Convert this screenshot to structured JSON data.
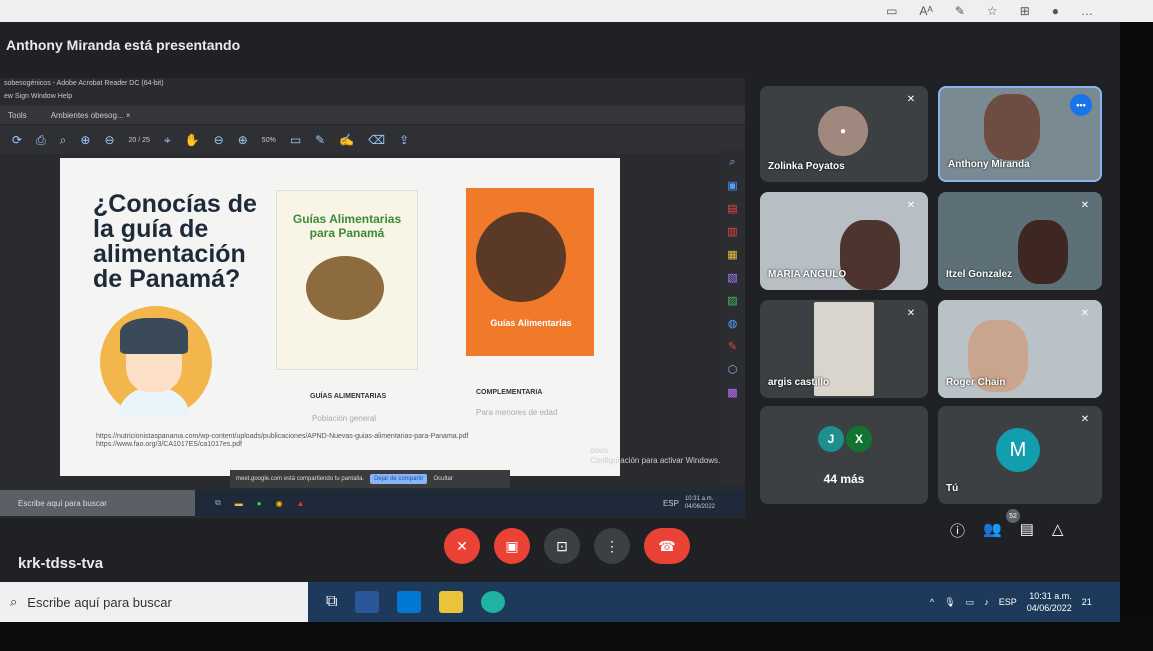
{
  "topbar": {
    "icons": [
      "window-icon",
      "text-size-icon",
      "read-aloud-icon",
      "favorites-icon",
      "collections-icon",
      "profile-icon",
      "more-icon"
    ]
  },
  "meet": {
    "presenting_text": "Anthony Miranda está presentando",
    "meeting_code": "krk-tdss-tva",
    "participants": [
      {
        "name": "Zolinka Poyatos"
      },
      {
        "name": "Anthony Miranda"
      },
      {
        "name": "MARIA ANGULO"
      },
      {
        "name": "Itzel Gonzalez"
      },
      {
        "name": "argis castillo"
      },
      {
        "name": "Roger Chain"
      }
    ],
    "more_tile": {
      "initials": [
        "J",
        "X"
      ],
      "label": "44 más"
    },
    "self_tile": {
      "initial": "M",
      "name": "Tú"
    },
    "people_count": "52"
  },
  "acrobat": {
    "title": "Ambientes obesog...",
    "window_title": "sobesogénicos - Adobe Acrobat Reader DC (64-bit)",
    "menu": "ew   Sign   Window   Help",
    "tabs": [
      "Tools",
      "Ambientes obesog...  ×"
    ],
    "page": "20 / 25",
    "zoom": "50%"
  },
  "slide": {
    "title": "¿Conocías de la guía de alimentación de Panamá?",
    "book1_title": "Guías Alimentarias para Panamá",
    "book2_title": "Guías Alimentarias",
    "caption1": "GUÍAS ALIMENTARIAS",
    "subcaption1": "Población general",
    "caption2": "COMPLEMENTARIA",
    "subcaption2": "Para menores de edad",
    "url1": "https://nutricionistaspanama.com/wp-content/uploads/publicaciones/APND-Nuevas-guias-alimentarias-para-Panama.pdf",
    "url2": "https://www.fao.org/3/CA1017ES/ca1017es.pdf"
  },
  "share_bar": {
    "text": "meet.google.com está compartiendo tu pantalla.",
    "stop": "Dejar de compartir",
    "hide": "Ocultar"
  },
  "windows_activation": {
    "line1": "dows",
    "line2": "Configuración para activar Windows."
  },
  "inner_taskbar": {
    "search": "Escribe aquí para buscar",
    "time": "10:31 a.m.",
    "date": "04/06/2022",
    "lang": "ESP"
  },
  "taskbar": {
    "search_placeholder": "Escribe aquí para buscar",
    "time": "10:31 a.m.",
    "date": "04/06/2022",
    "lang": "ESP",
    "notifications": "21"
  }
}
